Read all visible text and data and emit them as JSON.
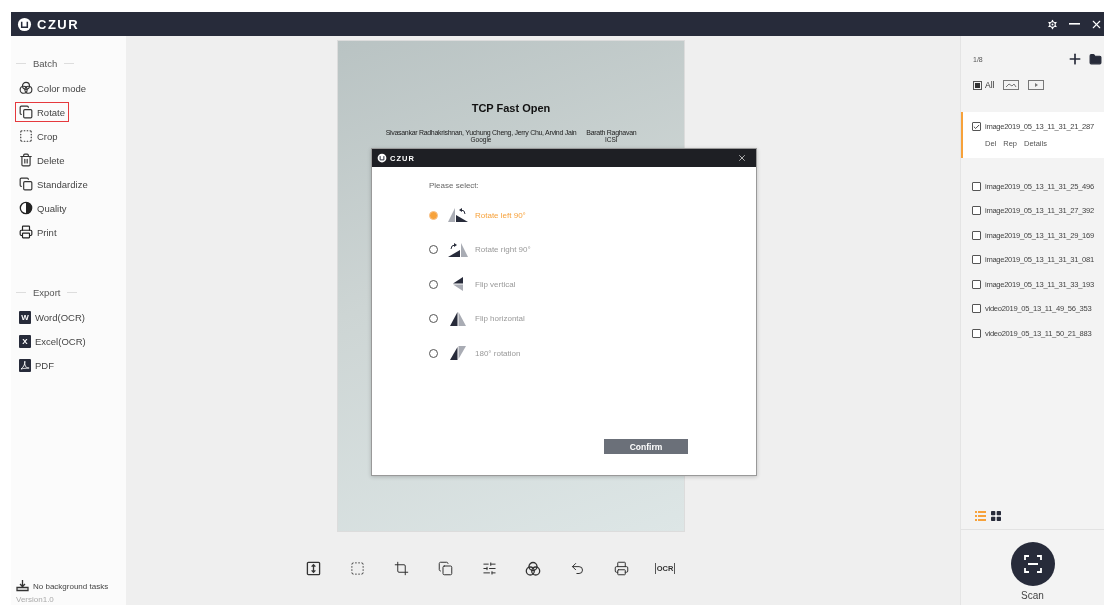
{
  "app": {
    "logo": "CZUR"
  },
  "sidebar": {
    "sections": [
      {
        "heading": "Batch",
        "items": [
          {
            "label": "Color mode",
            "kind": "color",
            "selected": false
          },
          {
            "label": "Rotate",
            "kind": "rotate",
            "selected": true
          },
          {
            "label": "Crop",
            "kind": "crop",
            "selected": false
          },
          {
            "label": "Delete",
            "kind": "delete",
            "selected": false
          },
          {
            "label": "Standardize",
            "kind": "standardize",
            "selected": false
          },
          {
            "label": "Quality",
            "kind": "quality",
            "selected": false
          },
          {
            "label": "Print",
            "kind": "print",
            "selected": false
          }
        ]
      },
      {
        "heading": "Export",
        "items": [
          {
            "label": "Word(OCR)",
            "kind": "letter",
            "icon_text": "W",
            "selected": false
          },
          {
            "label": "Excel(OCR)",
            "kind": "letter",
            "icon_text": "X",
            "selected": false
          },
          {
            "label": "PDF",
            "kind": "pdf",
            "selected": false
          }
        ]
      }
    ],
    "status": "No background tasks",
    "version": "Version1.0"
  },
  "document": {
    "title": "TCP Fast Open",
    "authors": [
      {
        "names": "Sivasankar Radhakrishnan, Yuchung Cheng, Jerry Chu, Arvind Jain",
        "affiliation": "Google"
      },
      {
        "names": "Barath Raghavan",
        "affiliation": "ICSI"
      }
    ]
  },
  "dialog": {
    "logo": "CZUR",
    "prompt": "Please select:",
    "options": [
      {
        "label": "Rotate left 90°",
        "kind": "rotate-left",
        "selected": true
      },
      {
        "label": "Rotate right 90°",
        "kind": "rotate-right",
        "selected": false
      },
      {
        "label": "Flip vertical",
        "kind": "flip-vertical",
        "selected": false
      },
      {
        "label": "Flip horizontal",
        "kind": "flip-horizontal",
        "selected": false
      },
      {
        "label": "180° rotation",
        "kind": "rotate-180",
        "selected": false
      }
    ],
    "confirm": "Confirm"
  },
  "toolbar": {
    "tools": [
      {
        "kind": "fit"
      },
      {
        "kind": "select"
      },
      {
        "kind": "crop"
      },
      {
        "kind": "rotate"
      },
      {
        "kind": "adjust"
      },
      {
        "kind": "color"
      },
      {
        "kind": "undo"
      },
      {
        "kind": "print"
      },
      {
        "kind": "ocr",
        "label": "OCR"
      }
    ]
  },
  "files": {
    "counter": "1/8",
    "filters": [
      {
        "kind": "all",
        "label": "All",
        "selected": true
      },
      {
        "kind": "image",
        "selected": false
      },
      {
        "kind": "video",
        "selected": false
      }
    ],
    "items": [
      {
        "name": "image2019_05_13_11_31_21_287",
        "checked": true,
        "selected": true,
        "actions": [
          "Del",
          "Rep",
          "Details"
        ]
      },
      {
        "name": "image2019_05_13_11_31_25_496",
        "checked": false,
        "selected": false
      },
      {
        "name": "image2019_05_13_11_31_27_392",
        "checked": false,
        "selected": false
      },
      {
        "name": "image2019_05_13_11_31_29_169",
        "checked": false,
        "selected": false
      },
      {
        "name": "image2019_05_13_11_31_31_081",
        "checked": false,
        "selected": false
      },
      {
        "name": "image2019_05_13_11_31_33_193",
        "checked": false,
        "selected": false
      },
      {
        "name": "video2019_05_13_11_49_56_353",
        "checked": false,
        "selected": false
      },
      {
        "name": "video2019_05_13_11_50_21_883",
        "checked": false,
        "selected": false
      }
    ],
    "views": [
      {
        "kind": "list",
        "selected": true
      },
      {
        "kind": "grid",
        "selected": false
      }
    ]
  },
  "scan": {
    "label": "Scan"
  }
}
